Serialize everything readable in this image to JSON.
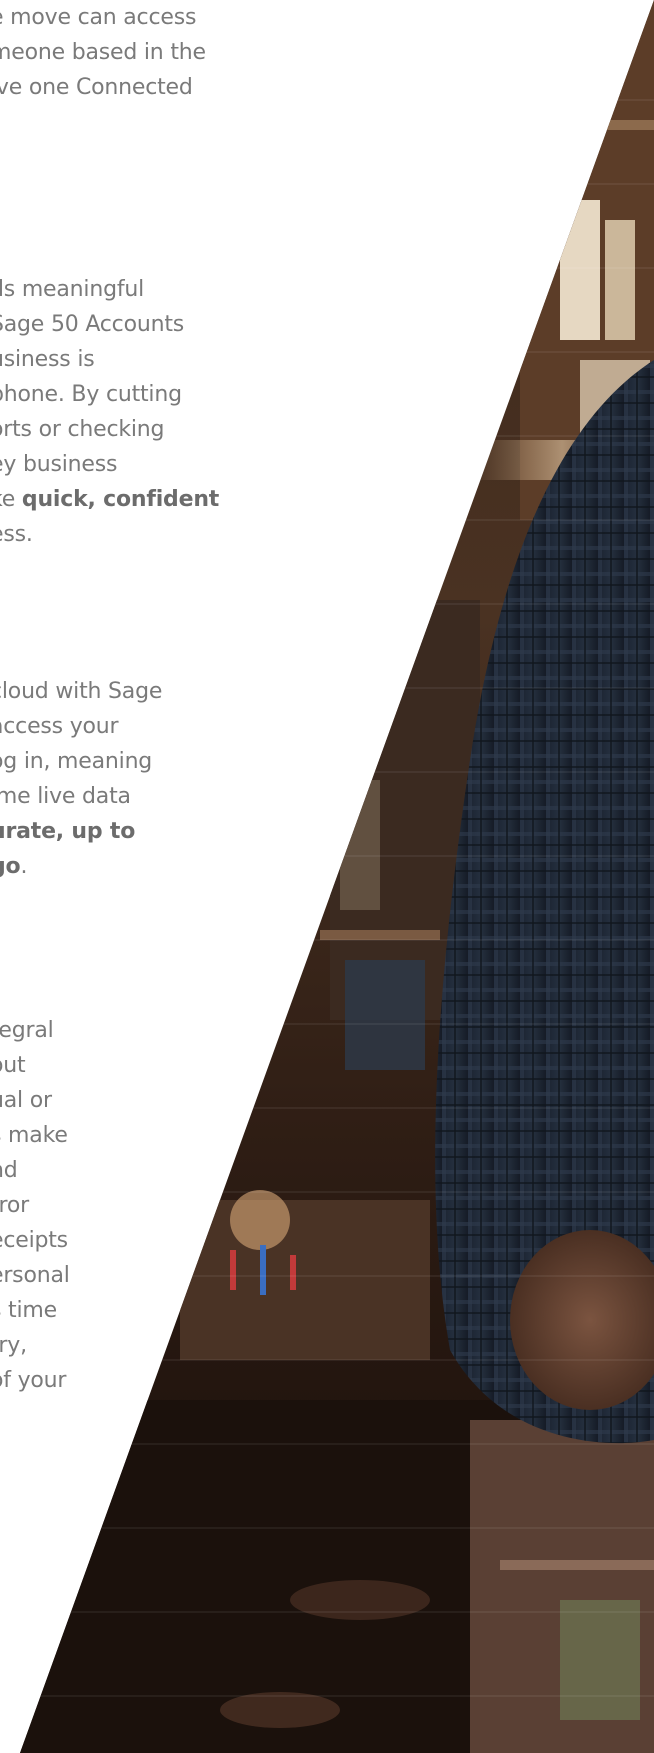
{
  "blocks": [
    {
      "id": "connected-users",
      "lines": [
        {
          "text": "e move can access"
        },
        {
          "text": "meone based in the"
        },
        {
          "text": "ive one Connected"
        },
        {
          "text": "."
        }
      ]
    },
    {
      "id": "mobile-app",
      "lines": [
        {
          "text": "ds meaningful"
        },
        {
          "text": "Sage 50 Accounts"
        },
        {
          "text": "usiness is"
        },
        {
          "text": "phone. By cutting"
        },
        {
          "text": "orts or checking"
        },
        {
          "text": "ey business"
        },
        {
          "pre": "ke ",
          "bold": "quick, confident"
        },
        {
          "text": "ess."
        }
      ]
    },
    {
      "id": "cloud-access",
      "lines": [
        {
          "text": "cloud with Sage"
        },
        {
          "text": "access your"
        },
        {
          "text": "og in, meaning"
        },
        {
          "text": "ime live data"
        },
        {
          "bold": "urate, up to"
        },
        {
          "bold": "go",
          "post": "."
        }
      ]
    },
    {
      "id": "receipts",
      "lines": [
        {
          "text": "tegral"
        },
        {
          "text": "out"
        },
        {
          "text": "ual or"
        },
        {
          "text": "s make"
        },
        {
          "text": "nd"
        },
        {
          "text": "rror"
        },
        {
          "text": "eceipts"
        },
        {
          "text": "ersonal"
        },
        {
          "text": "s time"
        },
        {
          "text": "try,"
        },
        {
          "text": "of your"
        }
      ]
    }
  ],
  "colors": {
    "text": "#7a7a7a",
    "text_bold": "#6c6c6c",
    "background": "#ffffff",
    "photo_shadow": "#1a0f0a",
    "photo_warm": "#8a5a35",
    "shirt": "#1e2633"
  }
}
